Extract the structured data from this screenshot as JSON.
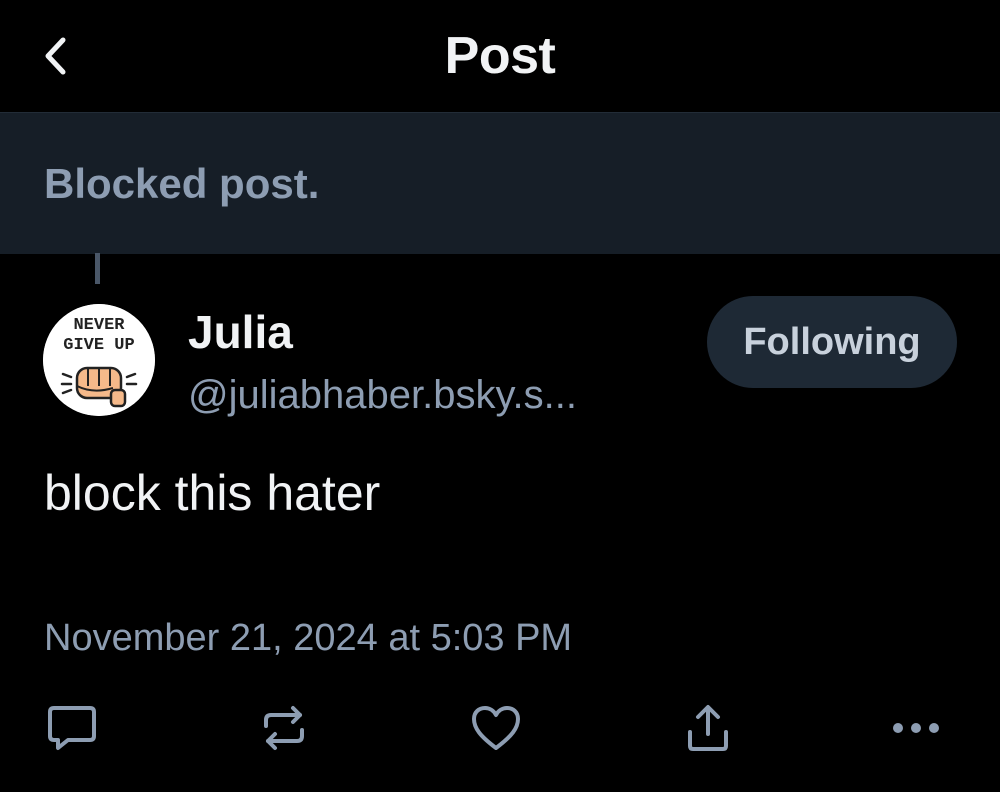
{
  "header": {
    "title": "Post"
  },
  "blocked": {
    "text": "Blocked post."
  },
  "post": {
    "author": {
      "name": "Julia",
      "handle": "@juliabhaber.bsky.s...",
      "avatar_text_top": "NEVER",
      "avatar_text_bottom": "GIVE UP"
    },
    "follow_label": "Following",
    "text": "block this hater",
    "timestamp": "November 21, 2024 at 5:03 PM"
  },
  "actions": [
    {
      "name": "reply-icon"
    },
    {
      "name": "repost-icon"
    },
    {
      "name": "like-icon"
    },
    {
      "name": "share-icon"
    },
    {
      "name": "more-icon"
    }
  ],
  "colors": {
    "background": "#000000",
    "banner": "#161e27",
    "muted_text": "#8d9db2",
    "button_bg": "#1e2935"
  }
}
